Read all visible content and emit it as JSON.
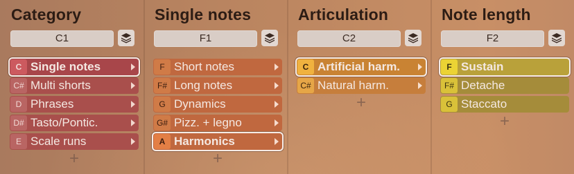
{
  "columns": [
    {
      "title": "Category",
      "key": "C1",
      "items": [
        {
          "note": "C",
          "label": "Single notes",
          "selected": true
        },
        {
          "note": "C#",
          "label": "Multi shorts",
          "selected": false
        },
        {
          "note": "D",
          "label": "Phrases",
          "selected": false
        },
        {
          "note": "D#",
          "label": "Tasto/Pontic.",
          "selected": false
        },
        {
          "note": "E",
          "label": "Scale runs",
          "selected": false
        }
      ],
      "add": "+"
    },
    {
      "title": "Single notes",
      "key": "F1",
      "items": [
        {
          "note": "F",
          "label": "Short notes",
          "selected": false
        },
        {
          "note": "F#",
          "label": "Long notes",
          "selected": false
        },
        {
          "note": "G",
          "label": "Dynamics",
          "selected": false
        },
        {
          "note": "G#",
          "label": "Pizz. + legno",
          "selected": false
        },
        {
          "note": "A",
          "label": "Harmonics",
          "selected": true
        }
      ],
      "add": "+"
    },
    {
      "title": "Articulation",
      "key": "C2",
      "items": [
        {
          "note": "C",
          "label": "Artificial harm.",
          "selected": true
        },
        {
          "note": "C#",
          "label": "Natural harm.",
          "selected": false
        }
      ],
      "add": "+"
    },
    {
      "title": "Note length",
      "key": "F2",
      "items": [
        {
          "note": "F",
          "label": "Sustain",
          "selected": true
        },
        {
          "note": "F#",
          "label": "Detache",
          "selected": false
        },
        {
          "note": "G",
          "label": "Staccato",
          "selected": false
        }
      ],
      "add": "+"
    }
  ],
  "icons": {
    "layers": "layers-icon",
    "submenu": "chevron-right-icon",
    "add": "plus-icon"
  },
  "colors": {
    "category": "#a94f4c",
    "single_notes": "#c0683f",
    "articulation": "#c67e3c",
    "note_length": "#a58c3a"
  }
}
